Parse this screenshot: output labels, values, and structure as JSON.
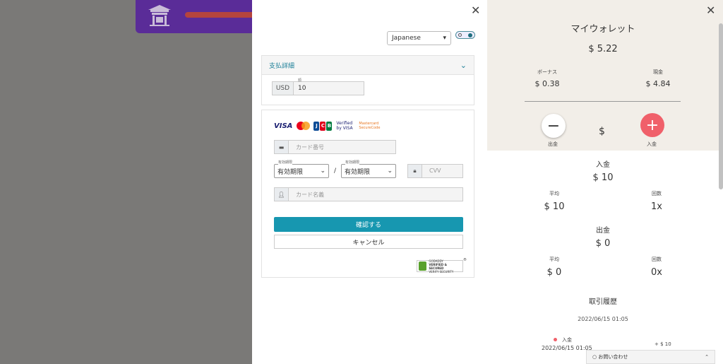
{
  "background_card": {
    "icon": "temple-icon"
  },
  "payment": {
    "language": "Japanese",
    "section_title": "支払詳細",
    "currency": "USD",
    "amount_label": "額",
    "amount": "10",
    "card_logos": [
      "VISA",
      "Verified by VISA",
      "Mastercard SecureCode"
    ],
    "card_number_placeholder": "カード番号",
    "expiry_label": "有効期限",
    "expiry_month": "有効期限",
    "expiry_year": "有効期限",
    "cvv_placeholder": "CVV",
    "card_name_placeholder": "カード名義",
    "confirm_label": "確認する",
    "cancel_label": "キャンセル",
    "secured_text_1": "GODADDY",
    "secured_text_2": "VERIFIED & SECURED",
    "secured_text_3": "VERIFY SECURITY"
  },
  "wallet": {
    "title": "マイウォレット",
    "total": "$ 5.22",
    "bonus_label": "ボーナス",
    "bonus_value": "$ 0.38",
    "cash_label": "現金",
    "cash_value": "$ 4.84",
    "withdraw_label": "出金",
    "currency_symbol": "$",
    "deposit_label": "入金",
    "deposit_section": "入金",
    "deposit_total": "$ 10",
    "dep_avg_label": "平均",
    "dep_avg_value": "$ 10",
    "dep_count_label": "回数",
    "dep_count_value": "1x",
    "withdraw_section": "出金",
    "withdraw_total": "$ 0",
    "wd_avg_label": "平均",
    "wd_avg_value": "$ 0",
    "wd_count_label": "回数",
    "wd_count_value": "0x",
    "history_title": "取引履歴",
    "history_date": "2022/06/15 01:05",
    "tx_type": "入金",
    "tx_datetime": "2022/06/15 01:05",
    "tx_amount": "+ $ 10",
    "chat_label": "お問い合わせ"
  },
  "colors": {
    "accent": "#1797b0",
    "plus": "#f0606a",
    "purple": "#5a2c98"
  }
}
